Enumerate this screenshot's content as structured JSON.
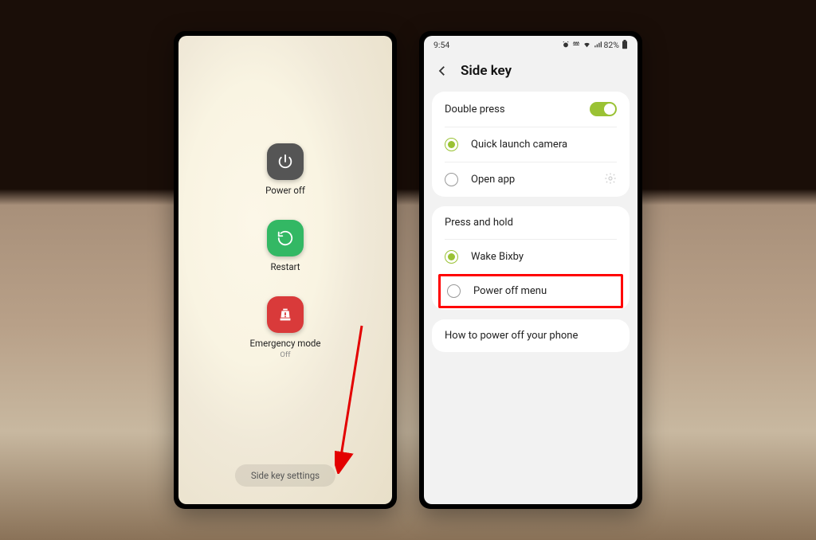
{
  "left": {
    "power_off": "Power off",
    "restart": "Restart",
    "emergency": "Emergency mode",
    "emergency_state": "Off",
    "side_key_settings": "Side key settings"
  },
  "right": {
    "status": {
      "time": "9:54",
      "battery_text": "82%"
    },
    "header_title": "Side key",
    "double_press": {
      "title": "Double press",
      "opt1": "Quick launch camera",
      "opt2": "Open app"
    },
    "press_hold": {
      "title": "Press and hold",
      "opt1": "Wake Bixby",
      "opt2": "Power off menu"
    },
    "how_to": "How to power off your phone"
  }
}
